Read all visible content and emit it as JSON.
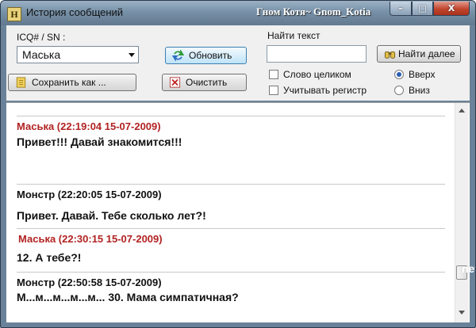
{
  "window": {
    "title": "История сообщений",
    "app_icon_letter": "H",
    "watermark": "Гном Котя~ Gnom_Kotia",
    "minimize_glyph": "–",
    "maximize_glyph": "□",
    "close_glyph": "X"
  },
  "toolbar": {
    "contact_label": "ICQ# / SN :",
    "contact_value": "Маська",
    "refresh_label": "Обновить",
    "save_label": "Сохранить как ...",
    "clear_label": "Очистить"
  },
  "search": {
    "label": "Найти текст",
    "value": "",
    "find_next_label": "Найти далее",
    "whole_word_label": "Слово целиком",
    "whole_word_checked": false,
    "match_case_label": "Учитывать регистр",
    "match_case_checked": false,
    "direction_up_label": "Вверх",
    "direction_down_label": "Вниз",
    "direction": "up"
  },
  "messages": [
    {
      "sender": "Маська",
      "header": "Маська (22:19:04 15-07-2009)",
      "text": "Привет!!! Давай знакомится!!!",
      "color": "#b22222"
    },
    {
      "sender": "Монстр",
      "header": "Монстр (22:20:05 15-07-2009)",
      "text": "Привет. Давай. Тебе сколько лет?!",
      "color": "#111111"
    },
    {
      "sender": "Маська",
      "header": "Маська (22:30:15 15-07-2009)",
      "text": "12. А тебе?!",
      "color": "#b22222"
    },
    {
      "sender": "Монстр",
      "header": "Монстр (22:50:58 15-07-2009)",
      "text": "М...м...м...м...м... 30. Мама симпатичная?",
      "color": "#111111"
    }
  ],
  "side_mark": "net",
  "colors": {
    "incoming": "#b22222",
    "outgoing": "#111111",
    "accent": "#3c7fb1"
  }
}
